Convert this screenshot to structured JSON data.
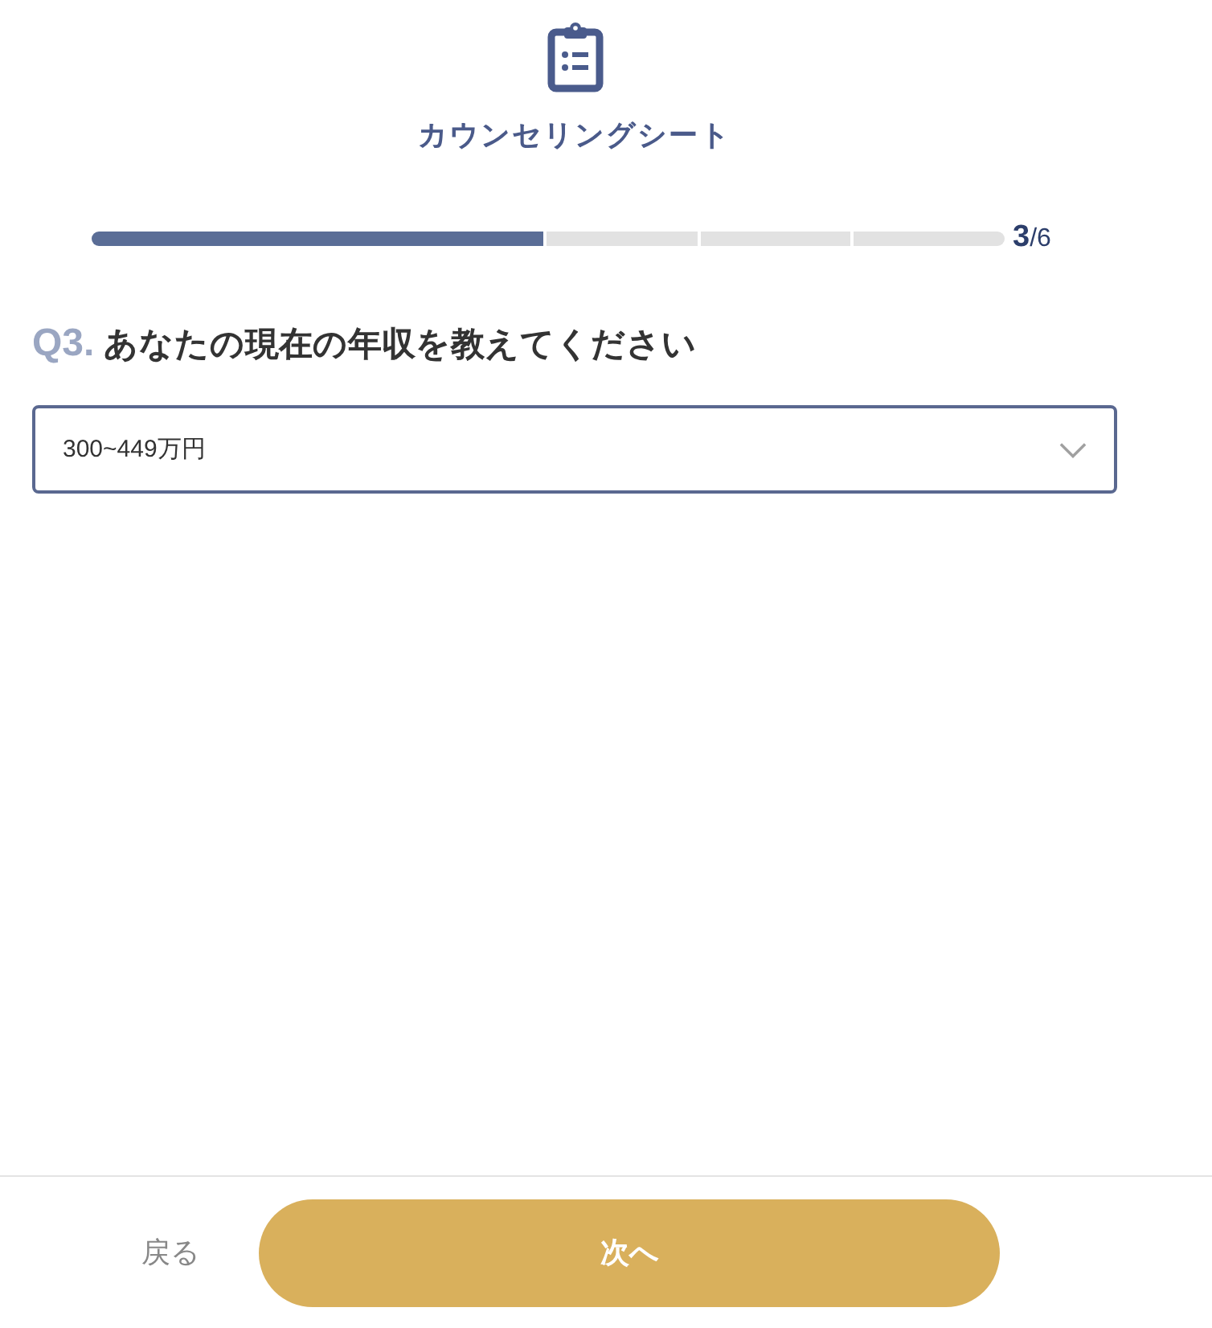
{
  "header": {
    "title": "カウンセリングシート"
  },
  "progress": {
    "segments": [
      {
        "filled": true
      },
      {
        "filled": true
      },
      {
        "filled": true
      },
      {
        "filled": false
      },
      {
        "filled": false
      },
      {
        "filled": false
      }
    ],
    "counter": "**3**/6"
  },
  "question": {
    "number": "Q3.",
    "text": "あなたの現在の年収を教えてください"
  },
  "select": {
    "value": "300~449万円"
  },
  "footer": {
    "back": "戻る",
    "next": "次へ"
  }
}
